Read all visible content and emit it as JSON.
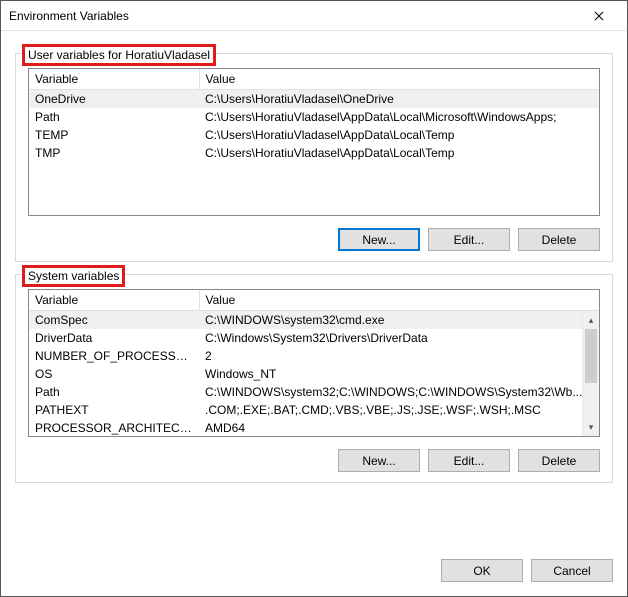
{
  "window": {
    "title": "Environment Variables"
  },
  "userGroup": {
    "legend": "User variables for HoratiuVladasel",
    "headers": {
      "var": "Variable",
      "val": "Value"
    },
    "rows": [
      {
        "var": "OneDrive",
        "val": "C:\\Users\\HoratiuVladasel\\OneDrive"
      },
      {
        "var": "Path",
        "val": "C:\\Users\\HoratiuVladasel\\AppData\\Local\\Microsoft\\WindowsApps;"
      },
      {
        "var": "TEMP",
        "val": "C:\\Users\\HoratiuVladasel\\AppData\\Local\\Temp"
      },
      {
        "var": "TMP",
        "val": "C:\\Users\\HoratiuVladasel\\AppData\\Local\\Temp"
      }
    ],
    "buttons": {
      "new": "New...",
      "edit": "Edit...",
      "del": "Delete"
    }
  },
  "sysGroup": {
    "legend": "System variables",
    "headers": {
      "var": "Variable",
      "val": "Value"
    },
    "rows": [
      {
        "var": "ComSpec",
        "val": "C:\\WINDOWS\\system32\\cmd.exe"
      },
      {
        "var": "DriverData",
        "val": "C:\\Windows\\System32\\Drivers\\DriverData"
      },
      {
        "var": "NUMBER_OF_PROCESSORS",
        "val": "2"
      },
      {
        "var": "OS",
        "val": "Windows_NT"
      },
      {
        "var": "Path",
        "val": "C:\\WINDOWS\\system32;C:\\WINDOWS;C:\\WINDOWS\\System32\\Wb..."
      },
      {
        "var": "PATHEXT",
        "val": ".COM;.EXE;.BAT;.CMD;.VBS;.VBE;.JS;.JSE;.WSF;.WSH;.MSC"
      },
      {
        "var": "PROCESSOR_ARCHITECTURE",
        "val": "AMD64"
      }
    ],
    "buttons": {
      "new": "New...",
      "edit": "Edit...",
      "del": "Delete"
    }
  },
  "footer": {
    "ok": "OK",
    "cancel": "Cancel"
  }
}
